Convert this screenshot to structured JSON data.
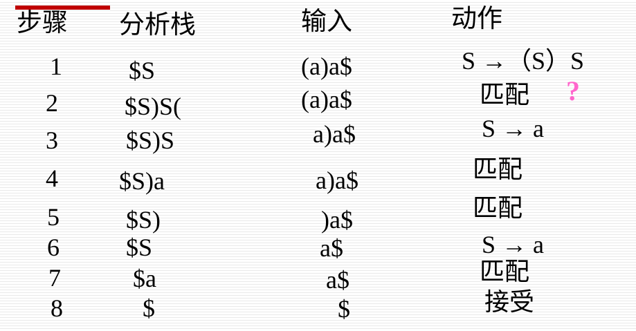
{
  "headers": {
    "step": "步骤",
    "stack": "分析栈",
    "input": "输入",
    "action": "动作"
  },
  "rows": [
    {
      "step": "1",
      "stack": "$S",
      "input": "(a)a$",
      "action": "S →（S）S"
    },
    {
      "step": "2",
      "stack": "$S)S(",
      "input": "(a)a$",
      "action": "匹配"
    },
    {
      "step": "3",
      "stack": "$S)S",
      "input": "a)a$",
      "action": "S → a"
    },
    {
      "step": "4",
      "stack": "$S)a",
      "input": "a)a$",
      "action": "匹配"
    },
    {
      "step": "5",
      "stack": "$S)",
      "input": ")a$",
      "action": "匹配"
    },
    {
      "step": "6",
      "stack": "$S",
      "input": "a$",
      "action": "S → a"
    },
    {
      "step": "7",
      "stack": "$a",
      "input": "a$",
      "action": "匹配"
    },
    {
      "step": "8",
      "stack": "$",
      "input": "$",
      "action": "接受"
    }
  ],
  "annotation": "?",
  "colors": {
    "accent_bar": "#c00000",
    "annotation": "#ff66cc",
    "stripe": "#e9e9e9"
  }
}
